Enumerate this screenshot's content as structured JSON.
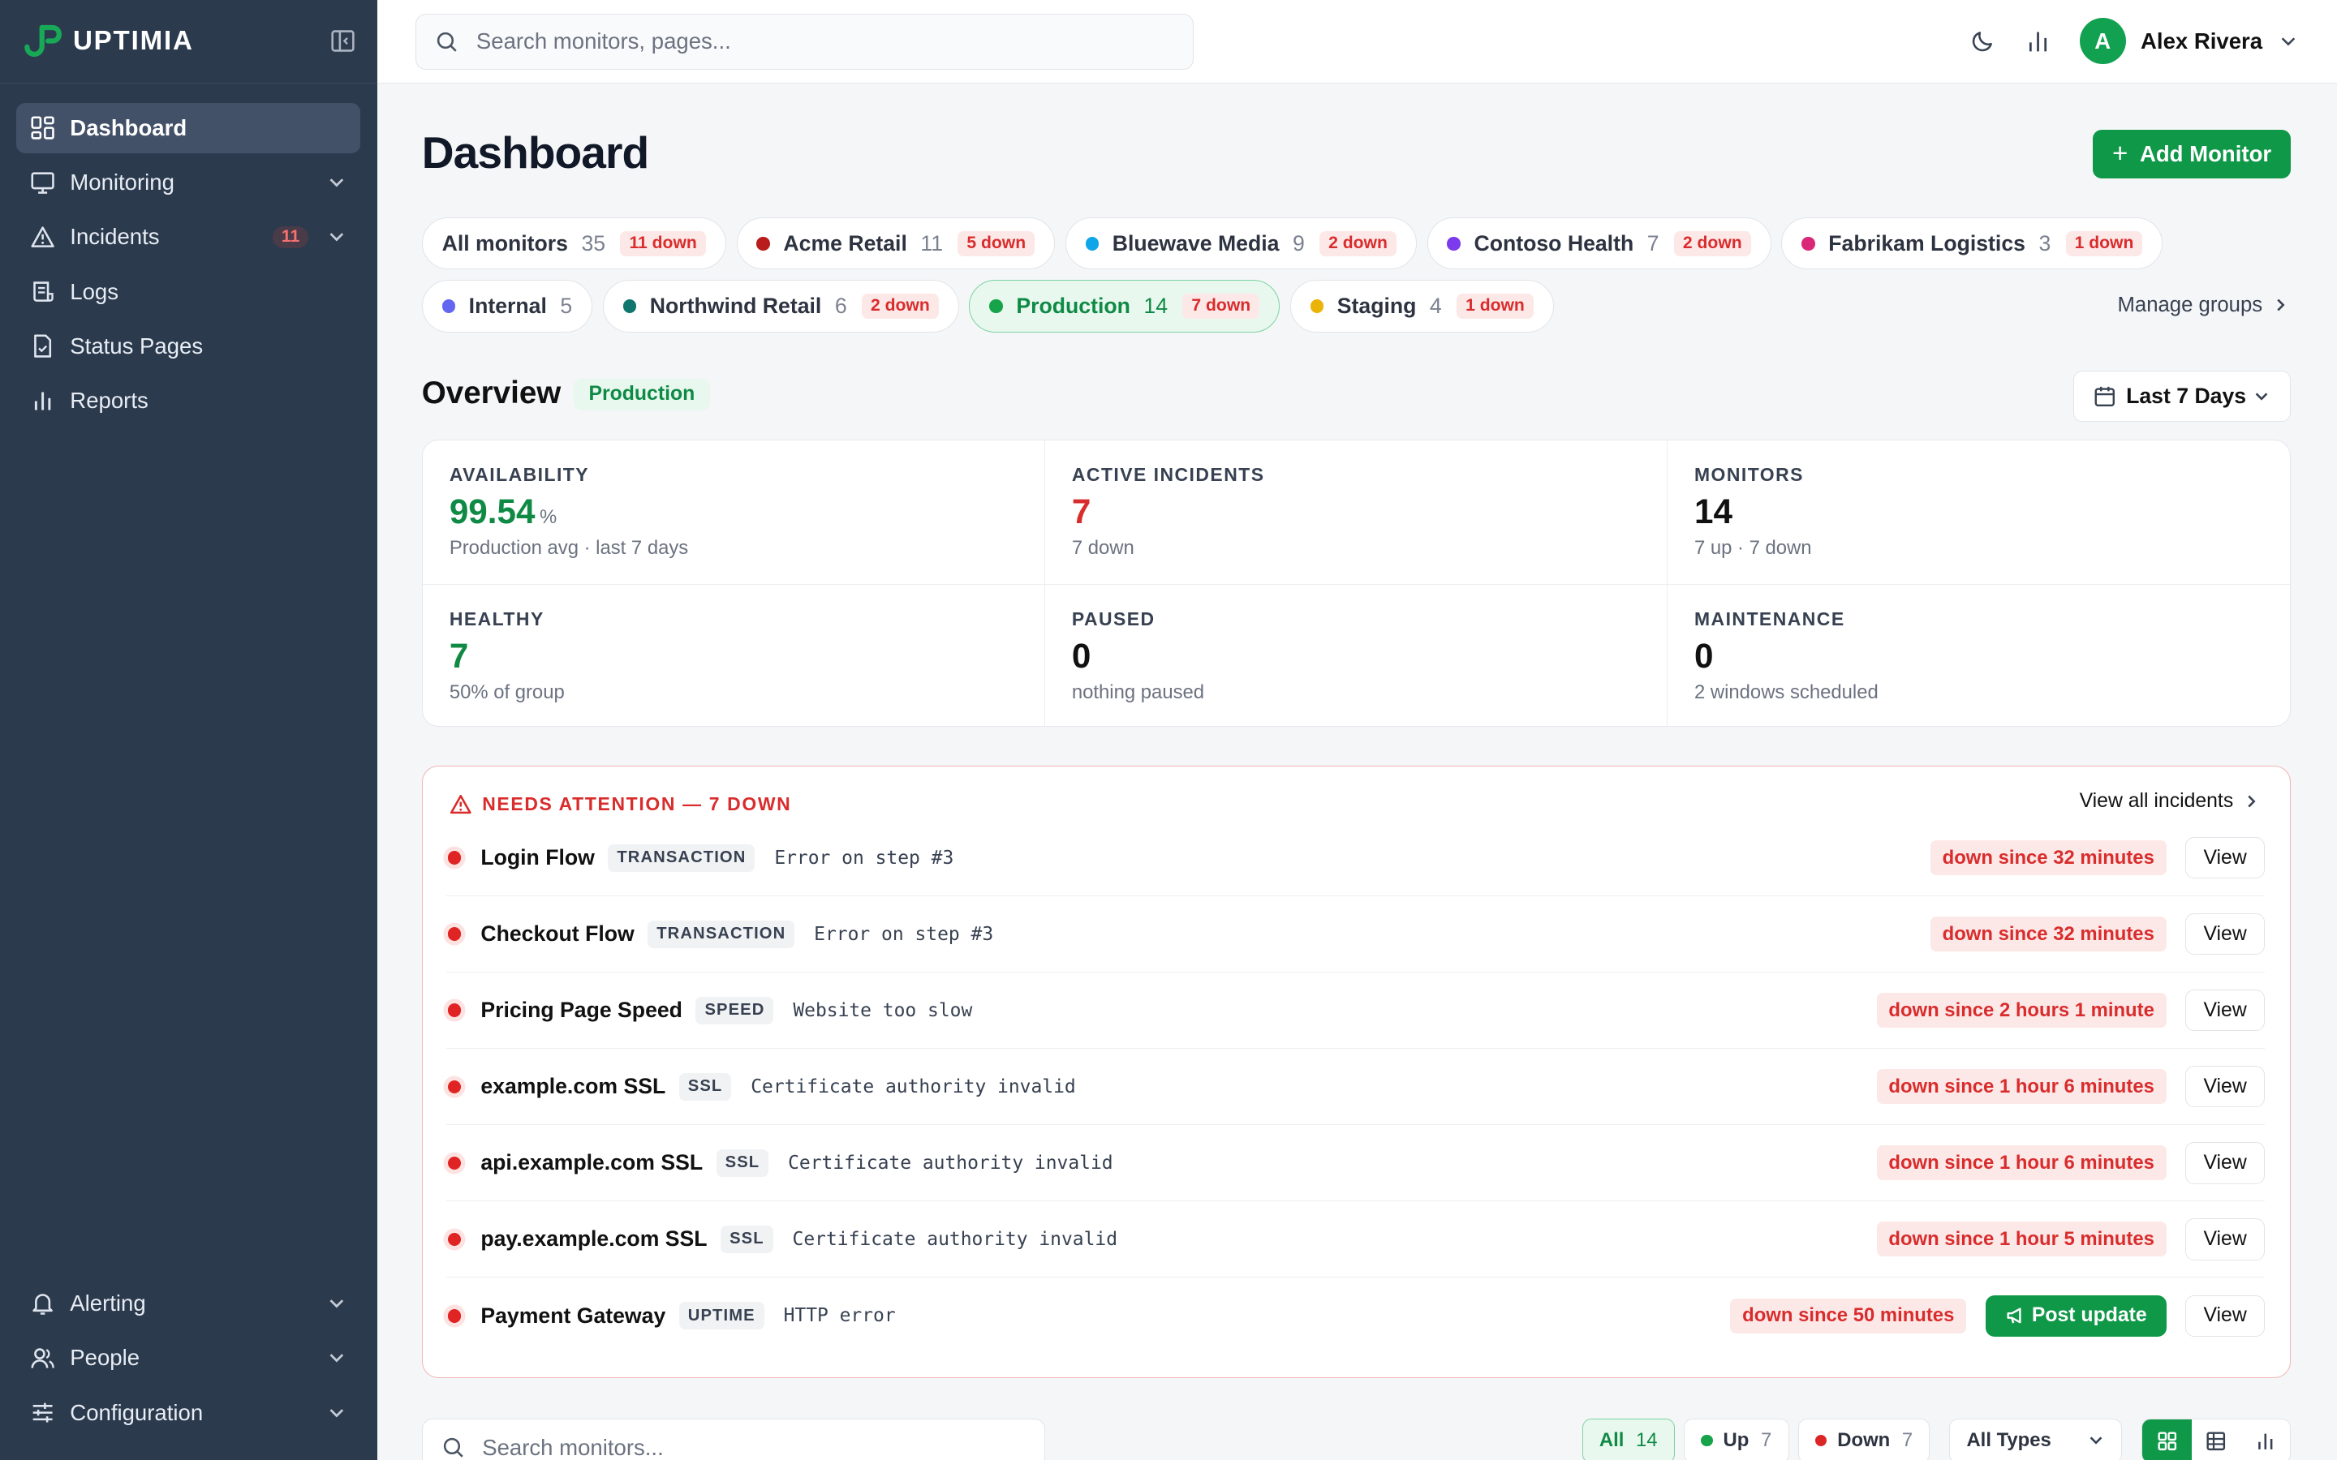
{
  "brand": {
    "name": "UPTIMIA"
  },
  "sidebar": {
    "items": [
      {
        "label": "Dashboard",
        "icon": "dashboard-icon"
      },
      {
        "label": "Monitoring",
        "icon": "monitor-icon"
      },
      {
        "label": "Incidents",
        "icon": "warning-icon",
        "badge": "11"
      },
      {
        "label": "Logs",
        "icon": "logs-icon"
      },
      {
        "label": "Status Pages",
        "icon": "status-page-icon"
      },
      {
        "label": "Reports",
        "icon": "bar-chart-icon"
      }
    ],
    "bottom": [
      {
        "label": "Alerting",
        "icon": "bell-icon"
      },
      {
        "label": "People",
        "icon": "people-icon"
      },
      {
        "label": "Configuration",
        "icon": "sliders-icon"
      }
    ]
  },
  "topbar": {
    "search_placeholder": "Search monitors, pages...",
    "user": {
      "initial": "A",
      "name": "Alex Rivera"
    }
  },
  "page": {
    "title": "Dashboard",
    "add_button": "Add Monitor",
    "manage_groups": "Manage groups"
  },
  "groups": [
    {
      "name": "All monitors",
      "count": "35",
      "down": "11 down"
    },
    {
      "name": "Acme Retail",
      "count": "11",
      "down": "5 down",
      "color": "#b91c1c"
    },
    {
      "name": "Bluewave Media",
      "count": "9",
      "down": "2 down",
      "color": "#0ea5e9"
    },
    {
      "name": "Contoso Health",
      "count": "7",
      "down": "2 down",
      "color": "#7c3aed"
    },
    {
      "name": "Fabrikam Logistics",
      "count": "3",
      "down": "1 down",
      "color": "#db2777"
    },
    {
      "name": "Internal",
      "count": "5",
      "color": "#6366f1"
    },
    {
      "name": "Northwind Retail",
      "count": "6",
      "down": "2 down",
      "color": "#0f766e"
    },
    {
      "name": "Production",
      "count": "14",
      "down": "7 down",
      "color": "#16a34a",
      "active": true
    },
    {
      "name": "Staging",
      "count": "4",
      "down": "1 down",
      "color": "#eab308"
    }
  ],
  "overview": {
    "title": "Overview",
    "tag": "Production",
    "range": "Last 7 Days",
    "stats": [
      {
        "label": "AVAILABILITY",
        "value": "99.54",
        "unit": "%",
        "sub": "Production avg · last 7 days"
      },
      {
        "label": "ACTIVE INCIDENTS",
        "value": "7",
        "sub": "7 down"
      },
      {
        "label": "MONITORS",
        "value": "14",
        "sub": "7 up · 7 down"
      },
      {
        "label": "HEALTHY",
        "value": "7",
        "sub": "50% of group"
      },
      {
        "label": "PAUSED",
        "value": "0",
        "sub": "nothing paused"
      },
      {
        "label": "MAINTENANCE",
        "value": "0",
        "sub": "2 windows scheduled"
      }
    ]
  },
  "attention": {
    "title": "NEEDS ATTENTION — 7 DOWN",
    "view_all": "View all incidents",
    "view_label": "View",
    "post_label": "Post update",
    "incidents": [
      {
        "name": "Login Flow",
        "type": "TRANSACTION",
        "error": "Error on step #3",
        "since": "down since 32 minutes"
      },
      {
        "name": "Checkout Flow",
        "type": "TRANSACTION",
        "error": "Error on step #3",
        "since": "down since 32 minutes"
      },
      {
        "name": "Pricing Page Speed",
        "type": "SPEED",
        "error": "Website too slow",
        "since": "down since 2 hours 1 minute"
      },
      {
        "name": "example.com SSL",
        "type": "SSL",
        "error": "Certificate authority invalid",
        "since": "down since 1 hour 6 minutes"
      },
      {
        "name": "api.example.com SSL",
        "type": "SSL",
        "error": "Certificate authority invalid",
        "since": "down since 1 hour 6 minutes"
      },
      {
        "name": "pay.example.com SSL",
        "type": "SSL",
        "error": "Certificate authority invalid",
        "since": "down since 1 hour 5 minutes"
      },
      {
        "name": "Payment Gateway",
        "type": "UPTIME",
        "error": "HTTP error",
        "since": "down since 50 minutes"
      }
    ]
  },
  "monitors_bar": {
    "search_placeholder": "Search monitors...",
    "filters": [
      {
        "label": "All",
        "count": "14"
      },
      {
        "label": "Up",
        "count": "7"
      },
      {
        "label": "Down",
        "count": "7"
      }
    ],
    "type_select": "All Types"
  }
}
